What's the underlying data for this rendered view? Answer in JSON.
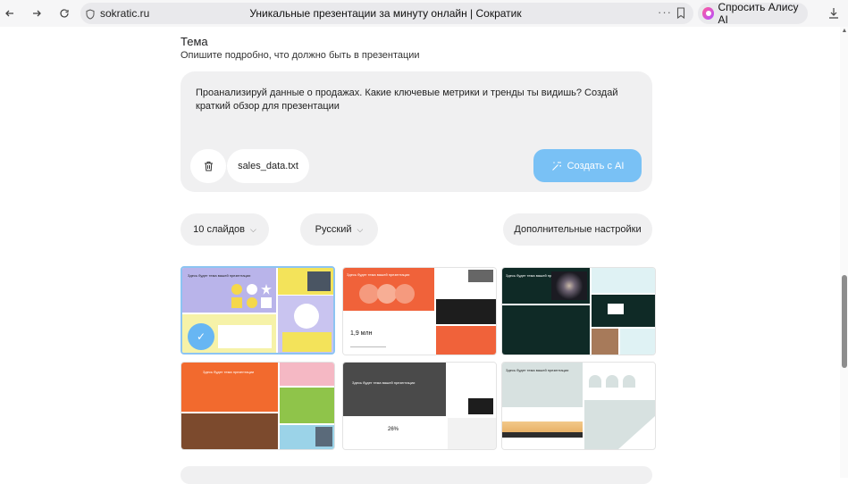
{
  "browser": {
    "site": "sokratic.ru",
    "title": "Уникальные презентации за минуту онлайн | Сократик",
    "alice_label": "Спросить Алису AI"
  },
  "theme": {
    "title": "Тема",
    "subtitle": "Опишите подробно, что должно быть в презентации",
    "prompt": "Проанализируй данные о продажах. Какие ключевые метрики и тренды ты видишь? Создай краткий обзор для презентации",
    "file_name": "sales_data.txt",
    "create_label": "Создать с AI"
  },
  "options": {
    "slides": "10 слайдов",
    "language": "Русский",
    "advanced": "Дополнительные настройки"
  },
  "templates": {
    "t1_title": "Здесь будет тема вашей презентации",
    "t2_title": "Здесь будет тема вашей презентации",
    "t2_value": "1,9 млн",
    "t3_title": "Здесь будет тема вашей презентации",
    "t4_title": "Здесь будет тема презентации",
    "t5_title": "Здесь будет тема вашей презентации",
    "t5_value": "26%",
    "t6_title": "Здесь будет тема вашей презентации"
  },
  "colors": {
    "accent": "#79c1f5",
    "selected_border": "#8cc4f2"
  }
}
